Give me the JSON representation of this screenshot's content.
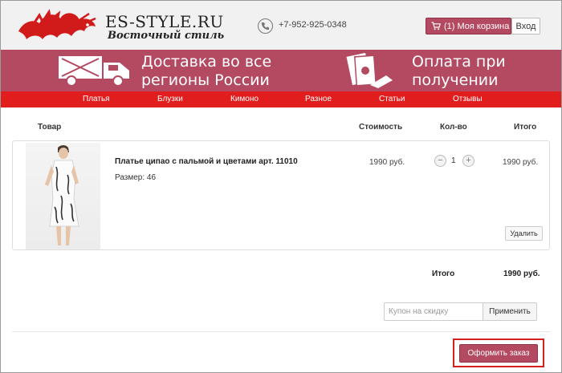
{
  "header": {
    "logo_title": "ES-STYLE.RU",
    "logo_subtitle": "Восточный стиль",
    "phone": "+7-952-925-0348",
    "cart_label": "(1) Моя корзина",
    "login_label": "Вход"
  },
  "banner": {
    "delivery_line1": "Доставка во все",
    "delivery_line2": "регионы России",
    "payment_line1": "Оплата при",
    "payment_line2": "получении"
  },
  "nav": {
    "items": [
      "Платья",
      "Блузки",
      "Кимоно",
      "Разное",
      "Статьи",
      "Отзывы"
    ]
  },
  "cart": {
    "headers": {
      "product": "Товар",
      "price": "Стоимость",
      "qty": "Кол-во",
      "total": "Итого"
    },
    "item": {
      "name": "Платье ципао с пальмой и цветами арт. 11010",
      "size": "Размер: 46",
      "price": "1990 руб.",
      "quantity": "1",
      "line_total": "1990 руб.",
      "delete_label": "Удалить"
    },
    "summary_label": "Итого",
    "summary_value": "1990 руб.",
    "coupon_placeholder": "Купон на скидку",
    "apply_label": "Применить",
    "checkout_label": "Оформить заказ"
  },
  "colors": {
    "brand": "#b34a61",
    "nav": "#e11d1d",
    "highlight": "#d51f1f"
  }
}
